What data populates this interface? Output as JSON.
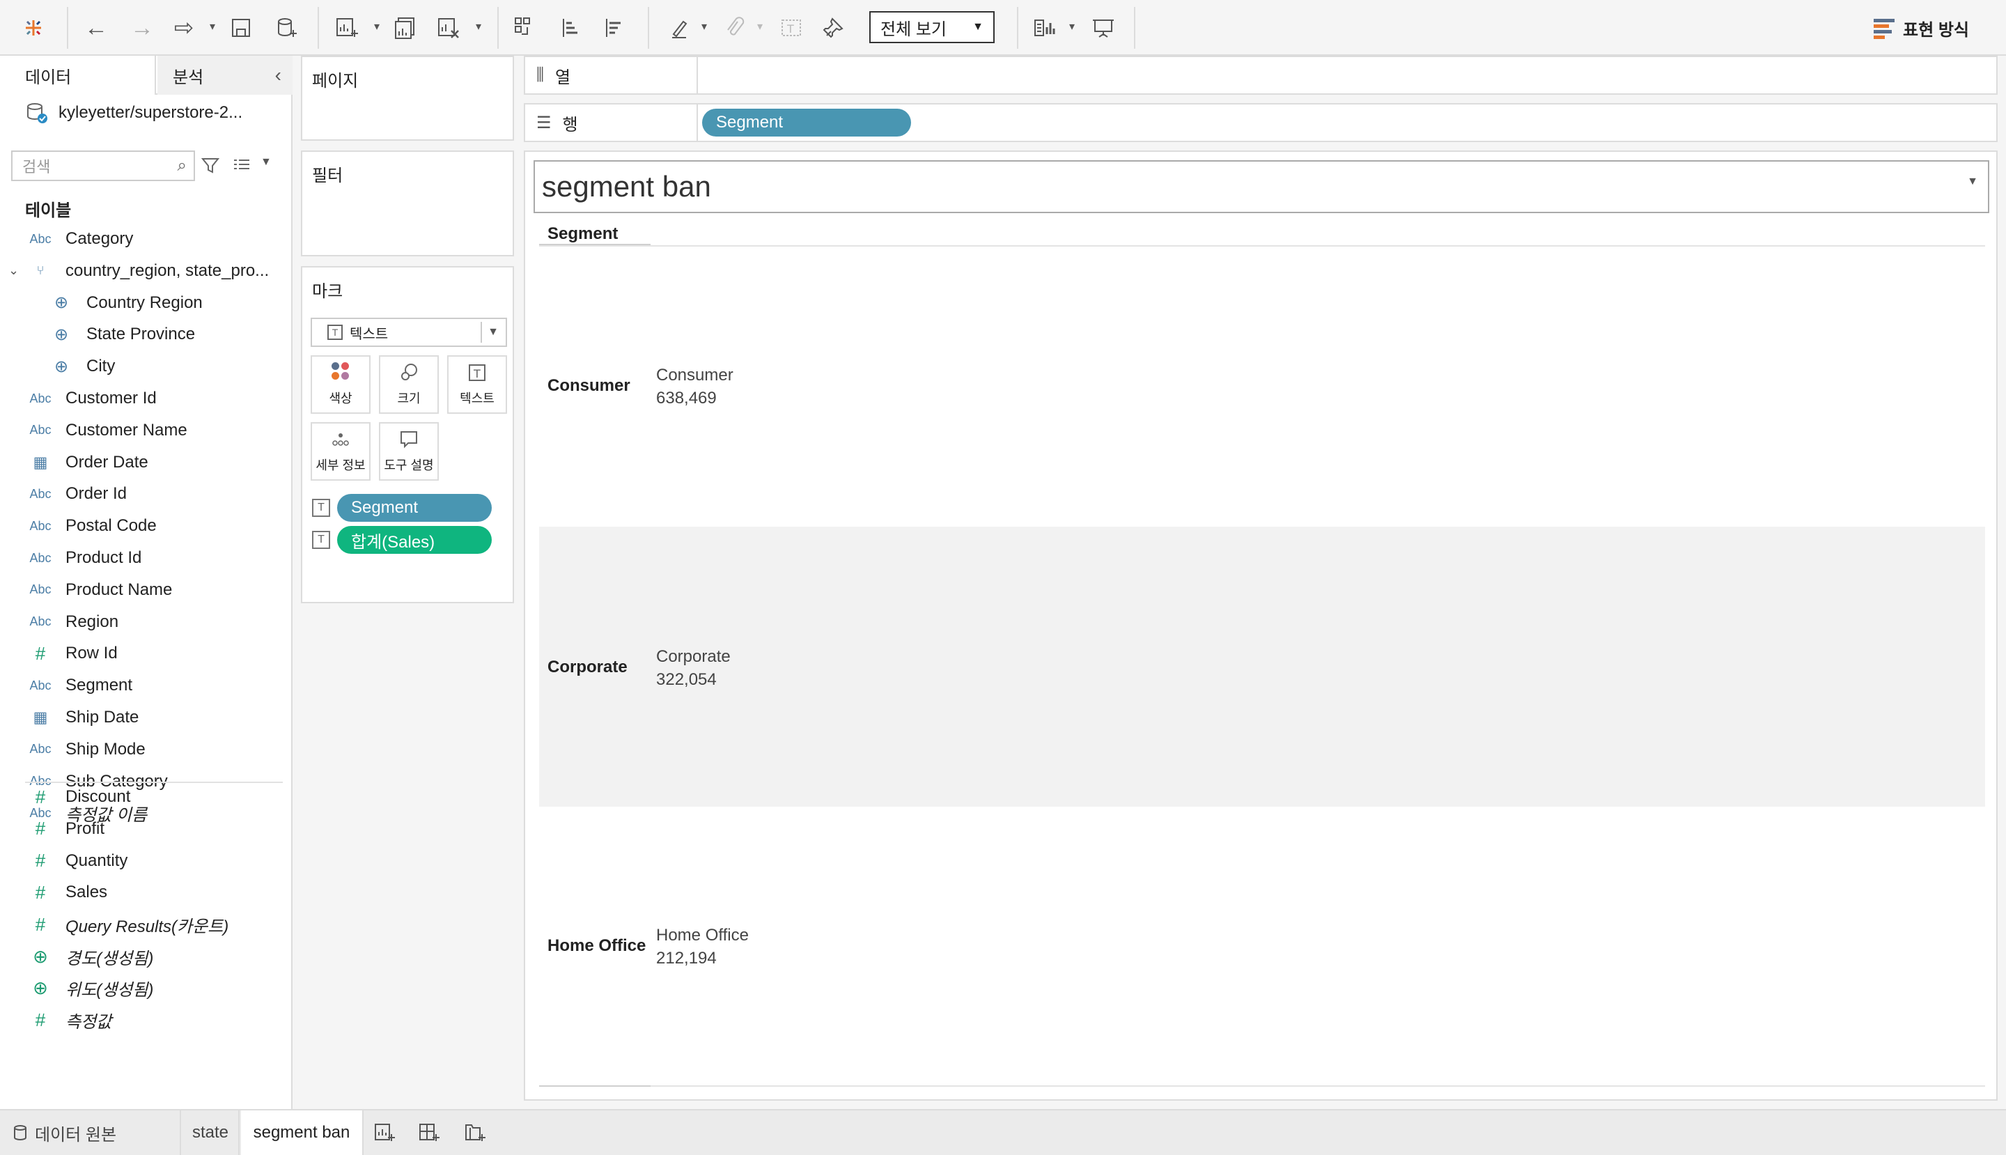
{
  "toolbar": {
    "view_mode": "전체 보기",
    "show_me": "표현 방식"
  },
  "data_pane": {
    "tab_data": "데이터",
    "tab_analytics": "분석",
    "datasource": "kyleyetter/superstore-2...",
    "search_placeholder": "검색",
    "tables_header": "테이블",
    "fields": [
      {
        "type": "Abc",
        "label": "Category"
      },
      {
        "type": "hier",
        "label": "country_region, state_pro..."
      },
      {
        "type": "geo",
        "label": "Country Region"
      },
      {
        "type": "geo",
        "label": "State Province"
      },
      {
        "type": "geo",
        "label": "City"
      },
      {
        "type": "Abc",
        "label": "Customer Id"
      },
      {
        "type": "Abc",
        "label": "Customer Name"
      },
      {
        "type": "date",
        "label": "Order Date"
      },
      {
        "type": "Abc",
        "label": "Order Id"
      },
      {
        "type": "Abc",
        "label": "Postal Code"
      },
      {
        "type": "Abc",
        "label": "Product Id"
      },
      {
        "type": "Abc",
        "label": "Product Name"
      },
      {
        "type": "Abc",
        "label": "Region"
      },
      {
        "type": "#",
        "label": "Row Id"
      },
      {
        "type": "Abc",
        "label": "Segment"
      },
      {
        "type": "date",
        "label": "Ship Date"
      },
      {
        "type": "Abc",
        "label": "Ship Mode"
      },
      {
        "type": "Abc",
        "label": "Sub Category"
      },
      {
        "type": "Abc",
        "label": "측정값 이름"
      }
    ],
    "measures": [
      {
        "type": "#",
        "label": "Discount"
      },
      {
        "type": "#",
        "label": "Profit"
      },
      {
        "type": "#",
        "label": "Quantity"
      },
      {
        "type": "#",
        "label": "Sales"
      },
      {
        "type": "#",
        "label": "Query Results(카운트)"
      },
      {
        "type": "geo",
        "label": "경도(생성됨)"
      },
      {
        "type": "geo",
        "label": "위도(생성됨)"
      },
      {
        "type": "#",
        "label": "측정값"
      }
    ]
  },
  "shelves": {
    "pages": "페이지",
    "filters": "필터",
    "marks": "마크",
    "mark_type": "텍스트",
    "mark_buttons": {
      "color": "색상",
      "size": "크기",
      "text": "텍스트",
      "detail": "세부 정보",
      "tooltip": "도구 설명"
    },
    "mark_pills": [
      "Segment",
      "합계(Sales)"
    ],
    "columns_label": "열",
    "rows_label": "행",
    "rows_pill": "Segment"
  },
  "view": {
    "title": "segment ban",
    "column_header": "Segment",
    "rows": [
      {
        "header": "Consumer",
        "label": "Consumer",
        "value": "638,469"
      },
      {
        "header": "Corporate",
        "label": "Corporate",
        "value": "322,054"
      },
      {
        "header": "Home Office",
        "label": "Home Office",
        "value": "212,194"
      }
    ]
  },
  "sheet_tabs": {
    "datasource": "데이터 원본",
    "tabs": [
      "state",
      "segment ban"
    ]
  },
  "colors": {
    "dimension_pill": "#4996b2",
    "measure_pill": "#0fb57f"
  }
}
